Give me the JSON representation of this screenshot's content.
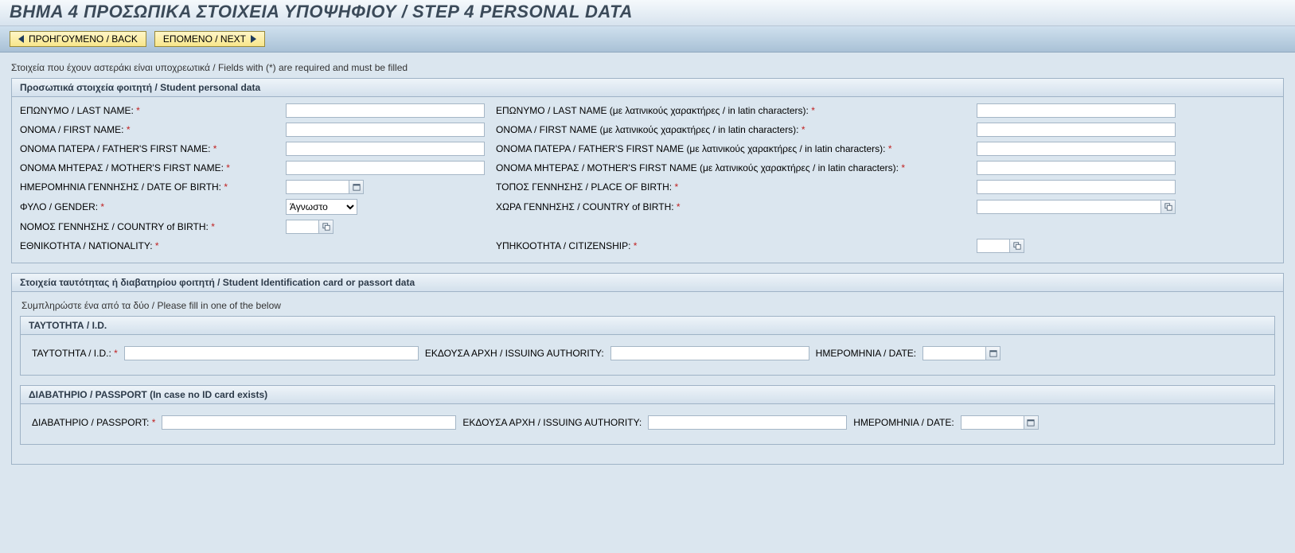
{
  "header": {
    "title": "ΒΗΜΑ 4 ΠΡΟΣΩΠΙΚΑ ΣΤΟΙΧΕΙΑ ΥΠΟΨΗΦΙΟΥ / STEP 4 PERSONAL DATA"
  },
  "toolbar": {
    "back_label": "ΠΡΟΗΓΟΥΜΕΝΟ / BACK",
    "next_label": "ΕΠΟΜΕΝΟ / NEXT"
  },
  "notes": {
    "required_note": "Στοιχεία που έχουν αστεράκι είναι υποχρεωτικά / Fields with (*) are required and must be filled",
    "id_note": "Συμπληρώστε ένα από τα δύο / Please fill in one of the below"
  },
  "group_personal": {
    "title": "Προσωπικά στοιχεία φοιτητή / Student personal data",
    "labels": {
      "last_name": "ΕΠΩΝΥΜΟ / LAST NAME:",
      "last_name_latin": "ΕΠΩΝΥΜΟ / LAST NAME (με λατινικούς χαρακτήρες / in latin characters):",
      "first_name": "ΟΝΟΜΑ / FIRST NAME:",
      "first_name_latin": "ΟΝΟΜΑ / FIRST NAME (με λατινικούς χαρακτήρες / in latin characters):",
      "father_name": "ΟΝΟΜΑ ΠΑΤΕΡΑ / FATHER'S FIRST NAME:",
      "father_name_latin": "ΟΝΟΜΑ ΠΑΤΕΡΑ / FATHER'S FIRST NAME (με λατινικούς χαρακτήρες / in latin characters):",
      "mother_name": "ΟΝΟΜΑ ΜΗΤΕΡΑΣ / MOTHER'S FIRST NAME:",
      "mother_name_latin": "ΟΝΟΜΑ ΜΗΤΕΡΑΣ / MOTHER'S FIRST NAME (με λατινικούς χαρακτήρες / in latin characters):",
      "dob": "ΗΜΕΡΟΜΗΝΙΑ ΓΕΝΝΗΣΗΣ / DATE OF BIRTH:",
      "place_of_birth": "ΤΟΠΟΣ ΓΕΝΝΗΣΗΣ / PLACE OF BIRTH:",
      "gender": "ΦΥΛΟ / GENDER:",
      "gender_value": "Άγνωστο",
      "country_birth2": "ΧΩΡΑ ΓΕΝΝΗΣΗΣ / COUNTRY of BIRTH:",
      "country_birth1": "ΝΟΜΟΣ ΓΕΝΝΗΣΗΣ / COUNTRY of BIRTH:",
      "nationality": "ΕΘΝΙΚΟΤΗΤΑ / NATIONALITY:",
      "citizenship": "ΥΠΗΚΟΟΤΗΤΑ / CITIZENSHIP:"
    }
  },
  "group_id": {
    "title": "Στοιχεία ταυτότητας ή διαβατηρίου φοιτητή / Student Identification card or passort data",
    "id_box_title": "ΤΑΥΤΟΤΗΤΑ / I.D.",
    "passport_box_title": "ΔΙΑΒΑΤΗΡΙΟ / PASSPORT (In case no ID card exists)",
    "labels": {
      "id": "ΤΑΥΤΟΤΗΤΑ / I.D.:",
      "issuing_authority": "ΕΚΔΟΥΣΑ ΑΡΧΗ / ISSUING AUTHORITY:",
      "date": "ΗΜΕΡΟΜΗΝΙΑ / DATE:",
      "passport": "ΔΙΑΒΑΤΗΡΙΟ / PASSPORT:"
    }
  },
  "asterisk": "*"
}
